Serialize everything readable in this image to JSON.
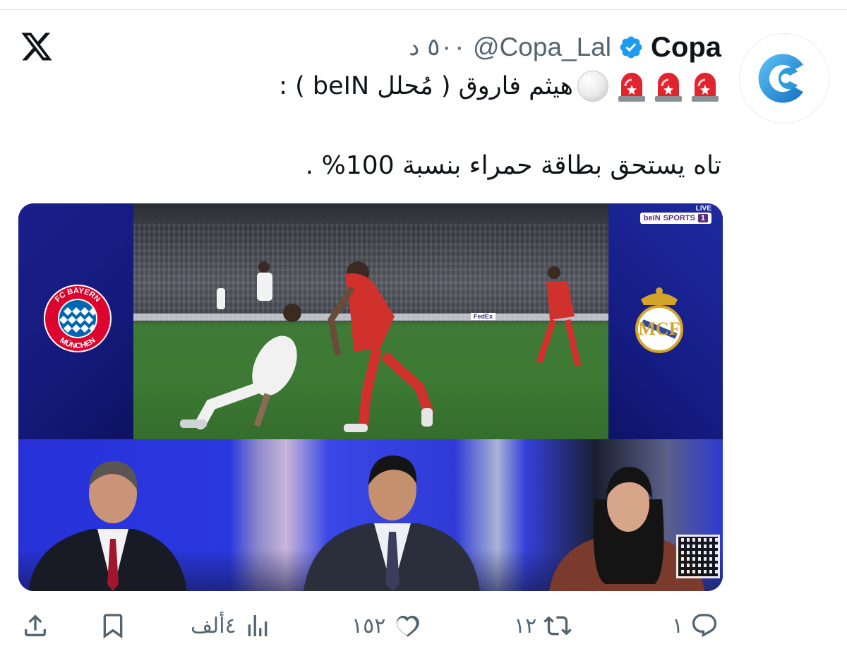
{
  "tweet": {
    "display_name": "Copa",
    "handle": "@Copa_Lal",
    "time": "٥٠٠ د",
    "text_line1": "هيثم فاروق ( مُحلل beIN ) :",
    "text_line2": "تاه يستحق بطاقة حمراء بنسبة 100% ."
  },
  "media": {
    "channel_live": "LIVE",
    "channel_name": "beIN",
    "channel_sports": "SPORTS",
    "channel_number": "1",
    "board_brand": "FedEx",
    "badge_left": "FC BAYERN MÜNCHEN",
    "badge_right": "Real Madrid"
  },
  "actions": {
    "reply_count": "١",
    "retweet_count": "١٢",
    "like_count": "١٥٢",
    "views_count": "٤ألف"
  },
  "colors": {
    "text": "#0f1419",
    "secondary": "#536471",
    "verified": "#1d9bf0",
    "avatar_brand": "#1b8fd6"
  }
}
